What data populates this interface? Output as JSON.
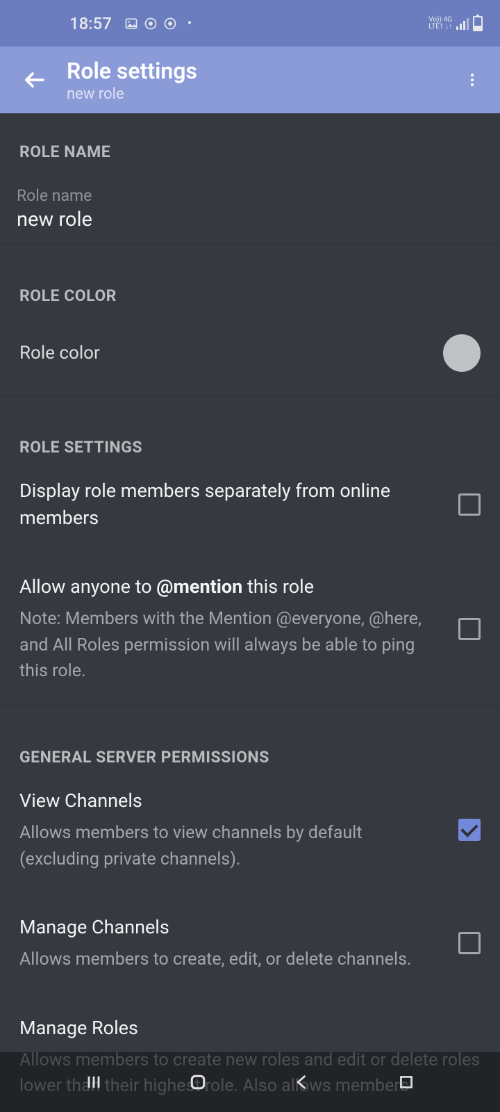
{
  "statusbar": {
    "time": "18:57",
    "net_line1": "Vo))   4G",
    "net_line2": "LTE1  ↓↑"
  },
  "header": {
    "title": "Role settings",
    "subtitle": "new role"
  },
  "sections": {
    "role_name_header": "ROLE NAME",
    "role_name_label": "Role name",
    "role_name_value": "new role",
    "role_color_header": "ROLE COLOR",
    "role_color_label": "Role color",
    "role_color_value": "#c0c1c4",
    "role_settings_header": "ROLE SETTINGS",
    "display_separately": {
      "title": "Display role members separately from online members",
      "checked": false
    },
    "allow_mention": {
      "title_pre": "Allow anyone to ",
      "title_bold": "@mention",
      "title_post": " this role",
      "desc": "Note: Members with the Mention @everyone, @here, and All Roles permission will always be able to ping this role.",
      "checked": false
    },
    "general_permissions_header": "GENERAL SERVER PERMISSIONS",
    "view_channels": {
      "title": "View Channels",
      "desc": "Allows members to view channels by default (excluding private channels).",
      "checked": true
    },
    "manage_channels": {
      "title": "Manage Channels",
      "desc": "Allows members to create, edit, or delete channels.",
      "checked": false
    },
    "manage_roles": {
      "title": "Manage Roles",
      "desc": "Allows members to create new roles and edit or delete roles lower than their highest role. Also allows members"
    }
  }
}
